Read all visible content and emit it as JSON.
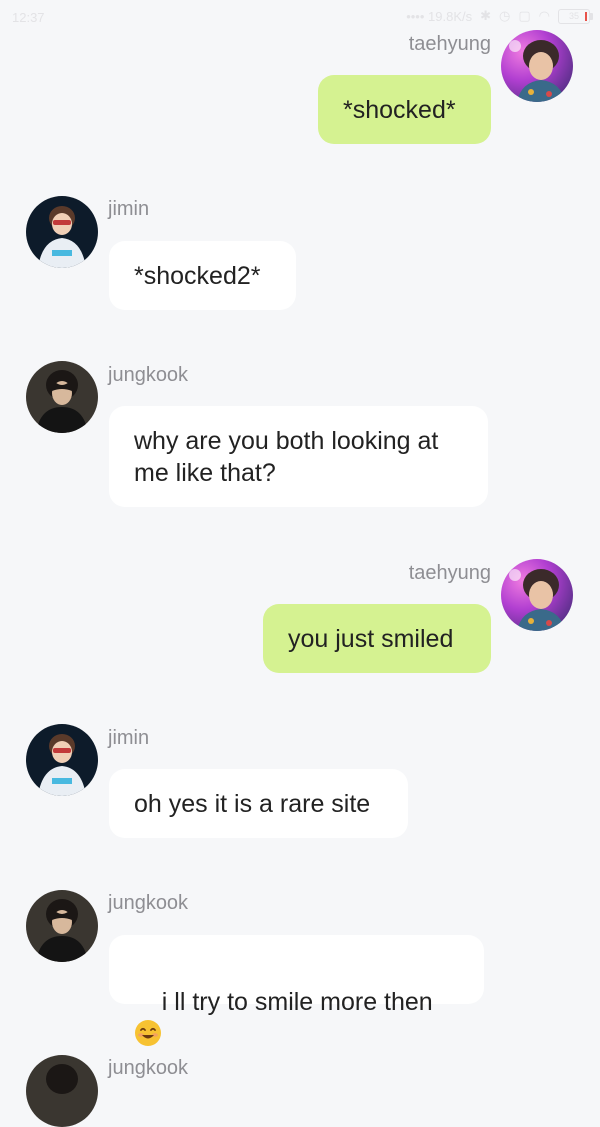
{
  "status_bar": {
    "time": "12:37",
    "network": "•••• 19.8K/s",
    "battery": "35"
  },
  "messages": [
    {
      "sender": "taehyung",
      "text": "*shocked*",
      "side": "right"
    },
    {
      "sender": "jimin",
      "text": "*shocked2*",
      "side": "left"
    },
    {
      "sender": "jungkook",
      "text": "why are you both looking at\nme like that?",
      "side": "left"
    },
    {
      "sender": "taehyung",
      "text": "you just smiled",
      "side": "right"
    },
    {
      "sender": "jimin",
      "text": "oh yes it is a rare site",
      "side": "left"
    },
    {
      "sender": "jungkook",
      "text": "i ll try to smile more then",
      "emoji": "smiling-face-emoji",
      "side": "left"
    },
    {
      "sender": "jungkook",
      "side": "left"
    }
  ],
  "colors": {
    "background": "#f6f7f9",
    "outgoing_bubble": "#d5f291",
    "incoming_bubble": "#ffffff",
    "sender_name": "#8e8e93",
    "message_text": "#222222"
  }
}
